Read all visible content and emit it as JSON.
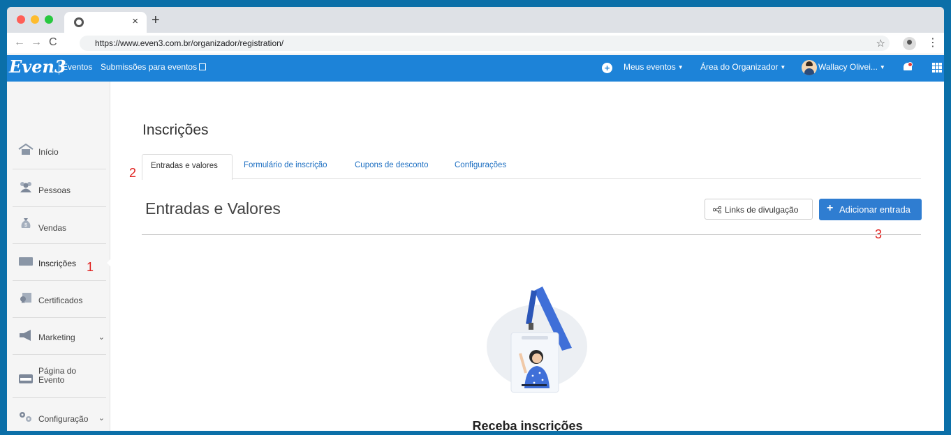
{
  "browser": {
    "url": "https://www.even3.com.br/organizador/registration/",
    "new_tab": "+",
    "close_tab": "×"
  },
  "appbar": {
    "logo": "Even3",
    "nav": {
      "eventos": "Eventos",
      "submissoes": "Submissões para eventos"
    },
    "menu": {
      "meus_eventos": "Meus eventos",
      "area_organizador": "Área do Organizador",
      "user": "Wallacy Olivei..."
    }
  },
  "sidebar": {
    "items": [
      {
        "label": "Início"
      },
      {
        "label": "Pessoas"
      },
      {
        "label": "Vendas"
      },
      {
        "label": "Inscrições"
      },
      {
        "label": "Certificados"
      },
      {
        "label": "Marketing"
      },
      {
        "label": "Página do Evento",
        "line1": "Página do",
        "line2": "Evento"
      },
      {
        "label": "Configuração"
      }
    ]
  },
  "main": {
    "page_title": "Inscrições",
    "tabs": [
      {
        "label": "Entradas e valores"
      },
      {
        "label": "Formulário de inscrição"
      },
      {
        "label": "Cupons de desconto"
      },
      {
        "label": "Configurações"
      }
    ],
    "section_title": "Entradas e Valores",
    "links_button": "Links de divulgação",
    "add_button": "Adicionar entrada",
    "empty_title": "Receba inscrições"
  },
  "annotations": {
    "a1": "1",
    "a2": "2",
    "a3": "3"
  },
  "colors": {
    "accent": "#1d83d8",
    "button": "#2f7dd1",
    "annotation": "#e0201e"
  }
}
